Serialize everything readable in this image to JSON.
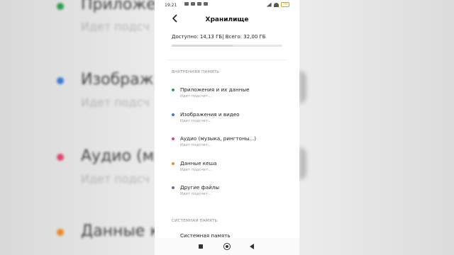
{
  "status_bar": {
    "time": "19:21",
    "battery": "70"
  },
  "header": {
    "title": "Хранилище"
  },
  "storage": {
    "summary": "Доступно: 14,13 ГБ| Всего: 32,00 ГБ",
    "used_fraction": 0.56
  },
  "internal": {
    "section_label": "ВНУТРЕННЯЯ ПАМЯТЬ",
    "items": [
      {
        "label": "Приложения и их данные",
        "subtitle": "Идет подсчет...",
        "color": "#2e9e4f"
      },
      {
        "label": "Изображения и видео",
        "subtitle": "Идет подсчет...",
        "color": "#3a7bd5"
      },
      {
        "label": "Аудио (музыка, рингтоны...)",
        "subtitle": "Идет подсчет...",
        "color": "#e0456a"
      },
      {
        "label": "Данные кеша",
        "subtitle": "Идет подсчет...",
        "color": "#f08a24"
      },
      {
        "label": "Другие файлы",
        "subtitle": "Идет подсчет...",
        "color": "#7b5ea7"
      }
    ]
  },
  "system": {
    "section_label": "СИСТЕМНАЯ ПАМЯТЬ",
    "items": [
      {
        "label": "Системная память"
      }
    ]
  },
  "background": {
    "items": [
      {
        "title": "Приложе",
        "subtitle": "Идет подсч",
        "color": "#2e9e4f"
      },
      {
        "title": "Изображ",
        "subtitle": "Идет подсч",
        "color": "#3a7bd5"
      },
      {
        "title": "Аудио (м",
        "subtitle": "Идет подсч",
        "color": "#e0456a"
      },
      {
        "title": "Данные к",
        "subtitle": "",
        "color": "#f08a24"
      }
    ]
  }
}
